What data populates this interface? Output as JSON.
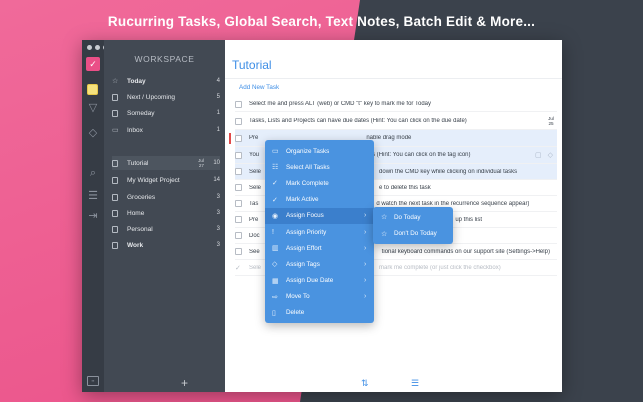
{
  "headline": "Rucurring Tasks, Global Search, Text Notes, Batch Edit & More...",
  "sidebar": {
    "workspace_title": "WORKSPACE",
    "smart_lists": [
      {
        "label": "Today",
        "count": "4",
        "icon": "star-icon"
      },
      {
        "label": "Next / Upcoming",
        "count": "5",
        "icon": "calendar-icon"
      },
      {
        "label": "Someday",
        "count": "1",
        "icon": "calendar-icon"
      },
      {
        "label": "Inbox",
        "count": "1",
        "icon": "inbox-icon"
      }
    ],
    "lists": [
      {
        "label": "Tutorial",
        "count": "10",
        "date_month": "Jul",
        "date_day": "27"
      },
      {
        "label": "My Widget Project",
        "count": "14"
      },
      {
        "label": "Groceries",
        "count": "3"
      },
      {
        "label": "Home",
        "count": "3"
      },
      {
        "label": "Personal",
        "count": "3"
      },
      {
        "label": "Work",
        "count": "3"
      }
    ],
    "add_label": "+"
  },
  "main": {
    "title": "Tutorial",
    "add_new_task": "Add New Task",
    "tasks": [
      {
        "text": "Select me and press ALT (web) or CMD \"t\" key to mark me for Today"
      },
      {
        "text": "Tasks, Lists and Projects can have due dates (Hint: You can click on the due date)",
        "date_month": "Jul",
        "date_day": "25"
      },
      {
        "text": "Pre",
        "text_right": "nable drag mode"
      },
      {
        "text": "You",
        "text_right": "ks (Hint: You can click on the tag icon)"
      },
      {
        "text": "Sele",
        "text_right": "down the CMD key while clicking on individual tasks"
      },
      {
        "text": "Sele",
        "text_right": "e to delete this task"
      },
      {
        "text": "Tas",
        "text_right": "d watch the next task in the recurrence sequence appear)"
      },
      {
        "text": "Pre",
        "text_right": "up this list"
      },
      {
        "text": "Doc",
        "text_right": ""
      },
      {
        "text": "See",
        "text_right": "tional keyboard commands on our support site (Settings->Help)"
      },
      {
        "text": "Sele",
        "text_right": "mark me complete (or just click the checkbox)"
      }
    ]
  },
  "context_menu": {
    "items": [
      {
        "label": "Organize Tasks",
        "icon": "organize-icon",
        "submenu": false
      },
      {
        "label": "Select All Tasks",
        "icon": "select-all-icon",
        "submenu": false
      },
      {
        "label": "Mark Complete",
        "icon": "checkmark-icon",
        "submenu": false
      },
      {
        "label": "Mark Active",
        "icon": "checkmark-icon",
        "submenu": false
      },
      {
        "label": "Assign Focus",
        "icon": "focus-icon",
        "submenu": true
      },
      {
        "label": "Assign Priority",
        "icon": "priority-icon",
        "submenu": true
      },
      {
        "label": "Assign Effort",
        "icon": "effort-icon",
        "submenu": true
      },
      {
        "label": "Assign Tags",
        "icon": "tag-icon",
        "submenu": true
      },
      {
        "label": "Assign Due Date",
        "icon": "due-date-icon",
        "submenu": true
      },
      {
        "label": "Move To",
        "icon": "move-icon",
        "submenu": true
      },
      {
        "label": "Delete",
        "icon": "delete-icon",
        "submenu": false
      }
    ],
    "submenu_items": [
      {
        "label": "Do Today",
        "icon": "star-icon"
      },
      {
        "label": "Don't Do Today",
        "icon": "star-outline-icon"
      }
    ]
  },
  "colors": {
    "accent_blue": "#3e8ee6",
    "menu_blue": "#4a93e0",
    "brand_pink": "#ea4f87",
    "sidebar_dark": "#424953",
    "iconbar_dark": "#363c45"
  }
}
